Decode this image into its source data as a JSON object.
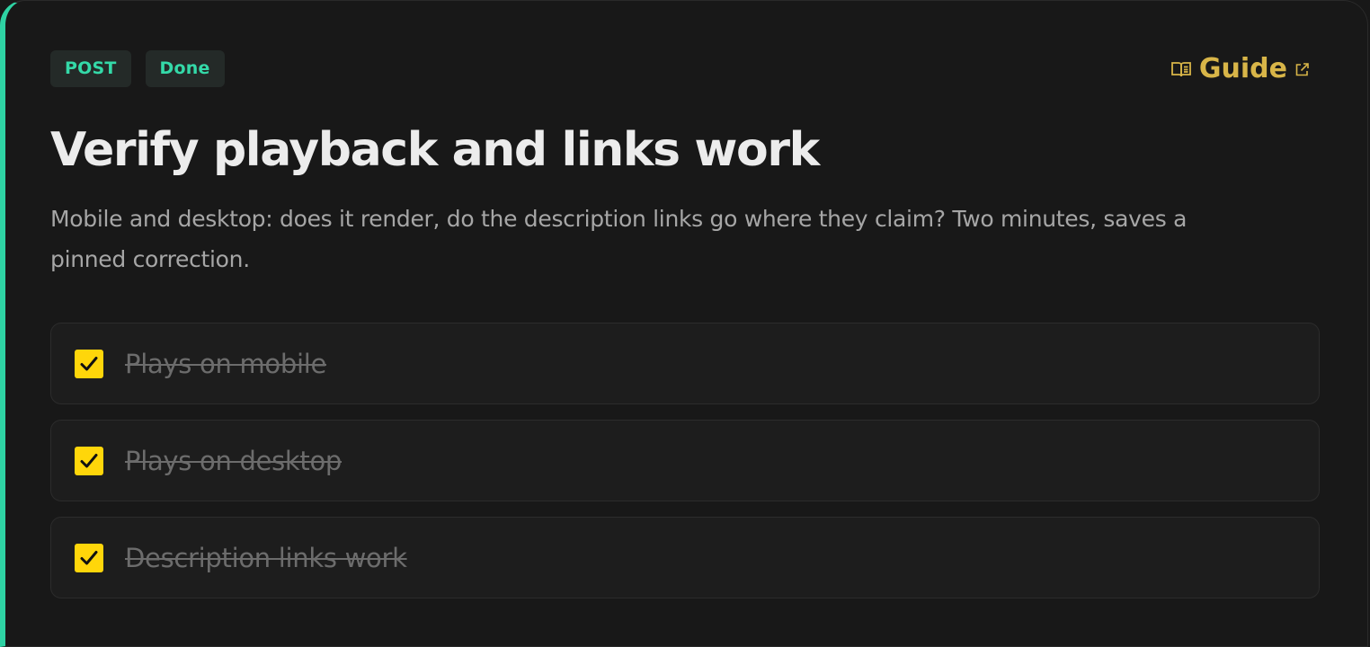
{
  "task": {
    "badges": {
      "type": "POST",
      "status": "Done"
    },
    "guide": {
      "label": "Guide",
      "icon": "book-icon",
      "external_icon": "external-link-icon",
      "color": "#d8b548"
    },
    "title": "Verify playback and links work",
    "description": "Mobile and desktop: does it render, do the description links go where they claim? Two minutes, saves a pinned correction.",
    "checklist": [
      {
        "label": "Plays on mobile",
        "checked": true
      },
      {
        "label": "Plays on desktop",
        "checked": true
      },
      {
        "label": "Description links work",
        "checked": true
      }
    ]
  },
  "colors": {
    "accent_border": "#2ed3a4",
    "badge_text": "#34d9a8",
    "checkbox_fill": "#ffd60a",
    "background": "#181818"
  }
}
